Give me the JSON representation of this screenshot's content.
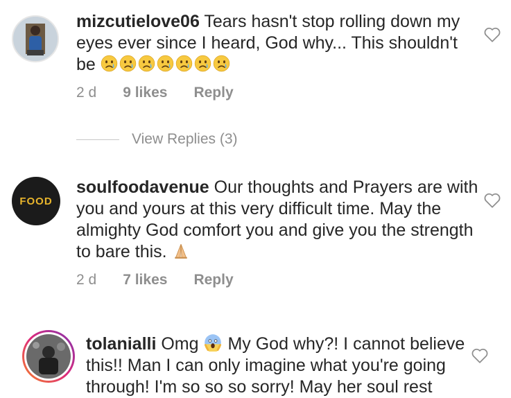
{
  "comments": [
    {
      "username": "mizcutielove06",
      "text": "Tears hasn't stop rolling down my eyes ever since I heard,  God  why... This shouldn't be",
      "emoji_count": 7,
      "age": "2 d",
      "likes": "9 likes",
      "reply_label": "Reply"
    },
    {
      "username": "soulfoodavenue",
      "text": "Our thoughts and Prayers are with you and yours at this very difficult time. May the almighty God comfort you and give you the strength to bare this.",
      "avatar_text": "FOOD",
      "age": "2 d",
      "likes": "7 likes",
      "reply_label": "Reply"
    },
    {
      "username": "tolanialli",
      "text_before": "Omg",
      "text_after": "My God why?! I cannot believe this!! Man I can only imagine what you're going through! I'm so so so sorry! May her soul rest"
    }
  ],
  "view_replies": "View Replies (3)",
  "colors": {
    "text": "#262626",
    "muted": "#8e8e8e",
    "story_ring_start": "#f58529",
    "story_ring_end": "#dd2a7b"
  }
}
